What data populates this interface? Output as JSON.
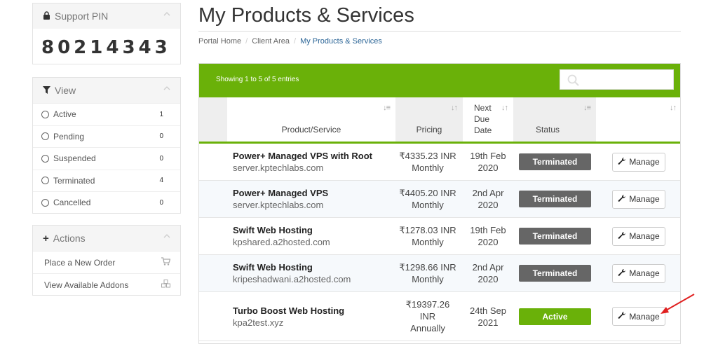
{
  "sidebar": {
    "support_pin": {
      "title": "Support PIN",
      "pin": "80214343"
    },
    "view": {
      "title": "View",
      "items": [
        {
          "label": "Active",
          "count": "1"
        },
        {
          "label": "Pending",
          "count": "0"
        },
        {
          "label": "Suspended",
          "count": "0"
        },
        {
          "label": "Terminated",
          "count": "4"
        },
        {
          "label": "Cancelled",
          "count": "0"
        }
      ]
    },
    "actions": {
      "title": "Actions",
      "items": [
        {
          "label": "Place a New Order",
          "icon": "cart-icon"
        },
        {
          "label": "View Available Addons",
          "icon": "cubes-icon"
        }
      ]
    }
  },
  "main": {
    "title": "My Products & Services",
    "breadcrumb": [
      "Portal Home",
      "Client Area",
      "My Products & Services"
    ],
    "entries_text": "Showing 1 to 5 of 5 entries",
    "search_placeholder": "",
    "columns": [
      "Product/Service",
      "Pricing",
      "Next Due Date",
      "Status",
      ""
    ],
    "column_labels": {
      "product": "Product/Service",
      "pricing": "Pricing",
      "due_1": "Next",
      "due_2": "Due",
      "due_3": "Date",
      "status": "Status"
    },
    "rows": [
      {
        "name": "Power+ Managed VPS with Root",
        "domain": "server.kptechlabs.com",
        "price": "₹4335.23 INR",
        "cycle": "Monthly",
        "due_1": "19th Feb",
        "due_2": "2020",
        "status": "Terminated",
        "action": "Manage"
      },
      {
        "name": "Power+ Managed VPS",
        "domain": "server.kptechlabs.com",
        "price": "₹4405.20 INR",
        "cycle": "Monthly",
        "due_1": "2nd Apr",
        "due_2": "2020",
        "status": "Terminated",
        "action": "Manage"
      },
      {
        "name": "Swift Web Hosting",
        "domain": "kpshared.a2hosted.com",
        "price": "₹1278.03 INR",
        "cycle": "Monthly",
        "due_1": "19th Feb",
        "due_2": "2020",
        "status": "Terminated",
        "action": "Manage"
      },
      {
        "name": "Swift Web Hosting",
        "domain": "kripeshadwani.a2hosted.com",
        "price": "₹1298.66 INR",
        "cycle": "Monthly",
        "due_1": "2nd Apr",
        "due_2": "2020",
        "status": "Terminated",
        "action": "Manage"
      },
      {
        "name": "Turbo Boost Web Hosting",
        "domain": "kpa2test.xyz",
        "price_1": "₹19397.26",
        "price_2": "INR",
        "cycle": "Annually",
        "due_1": "24th Sep",
        "due_2": "2021",
        "status": "Active",
        "action": "Manage"
      }
    ]
  },
  "colors": {
    "accent_green": "#6ab109",
    "terminated_gray": "#666666",
    "arrow_red": "#e02020"
  }
}
